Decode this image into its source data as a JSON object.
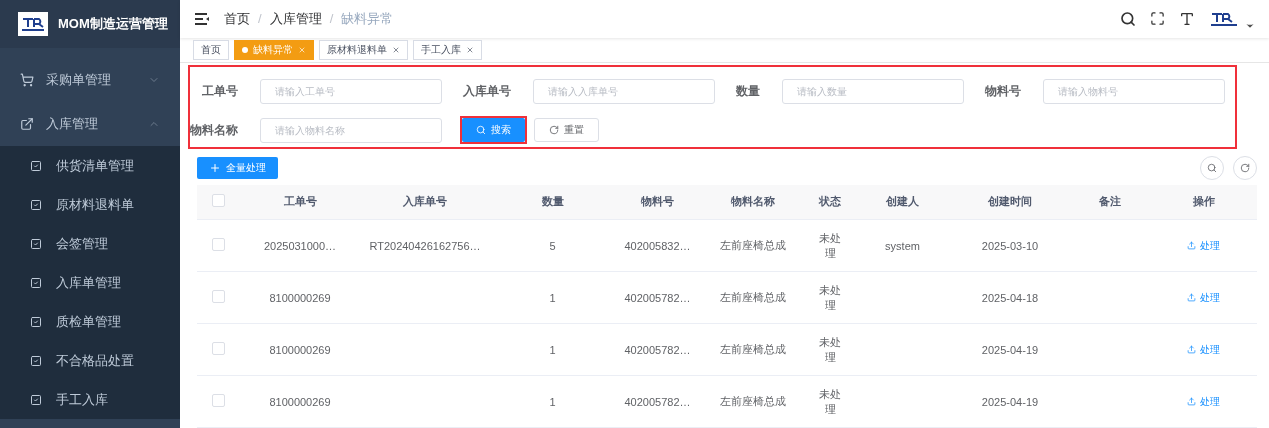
{
  "sidebar": {
    "title": "MOM制造运营管理",
    "items": [
      {
        "label": "采购单管理",
        "expanded": false
      },
      {
        "label": "入库管理",
        "expanded": true,
        "children": [
          {
            "label": "供货清单管理"
          },
          {
            "label": "原材料退料单"
          },
          {
            "label": "会签管理"
          },
          {
            "label": "入库单管理"
          },
          {
            "label": "质检单管理"
          },
          {
            "label": "不合格品处置"
          },
          {
            "label": "手工入库"
          }
        ]
      }
    ]
  },
  "breadcrumb": [
    {
      "label": "首页"
    },
    {
      "separator": "/",
      "label": "入库管理"
    },
    {
      "separator": "/",
      "label": "缺料异常"
    }
  ],
  "tags": [
    {
      "label": "首页",
      "selected": false,
      "closable": false
    },
    {
      "label": "缺料异常",
      "selected": true,
      "closable": true
    },
    {
      "label": "原材料退料单",
      "selected": false,
      "closable": true
    },
    {
      "label": "手工入库",
      "selected": false,
      "closable": true
    }
  ],
  "search_panel": {
    "highlighted": true,
    "fields": [
      {
        "label": "工单号",
        "placeholder": "请输入工单号"
      },
      {
        "label": "入库单号",
        "placeholder": "请输入入库单号"
      },
      {
        "label": "数量",
        "placeholder": "请输入数量"
      },
      {
        "label": "物料号",
        "placeholder": "请输入物料号"
      },
      {
        "label": "物料名称",
        "placeholder": "请输入物料名称"
      }
    ],
    "search_button": {
      "label": "搜索",
      "highlighted": true
    },
    "reset_button": {
      "label": "重置"
    }
  },
  "process_all_button": "全量处理",
  "table": {
    "select_all_checked": false,
    "columns": [
      "工单号",
      "入库单号",
      "数量",
      "物料号",
      "物料名称",
      "状态",
      "创建人",
      "创建时间",
      "备注",
      "操作"
    ],
    "rows": [
      {
        "checked": false,
        "cells": [
          "2025031000…",
          "RT20240426162756…",
          "5",
          "402005832…",
          "左前座椅总成",
          "未处理",
          "system",
          "2025-03-10",
          ""
        ],
        "action": "处理"
      },
      {
        "checked": false,
        "cells": [
          "8100000269",
          "",
          "1",
          "402005782…",
          "左前座椅总成",
          "未处理",
          "",
          "2025-04-18",
          ""
        ],
        "action": "处理"
      },
      {
        "checked": false,
        "cells": [
          "8100000269",
          "",
          "1",
          "402005782…",
          "左前座椅总成",
          "未处理",
          "",
          "2025-04-19",
          ""
        ],
        "action": "处理"
      },
      {
        "checked": false,
        "cells": [
          "8100000269",
          "",
          "1",
          "402005782…",
          "左前座椅总成",
          "未处理",
          "",
          "2025-04-19",
          ""
        ],
        "action": "处理"
      }
    ]
  }
}
